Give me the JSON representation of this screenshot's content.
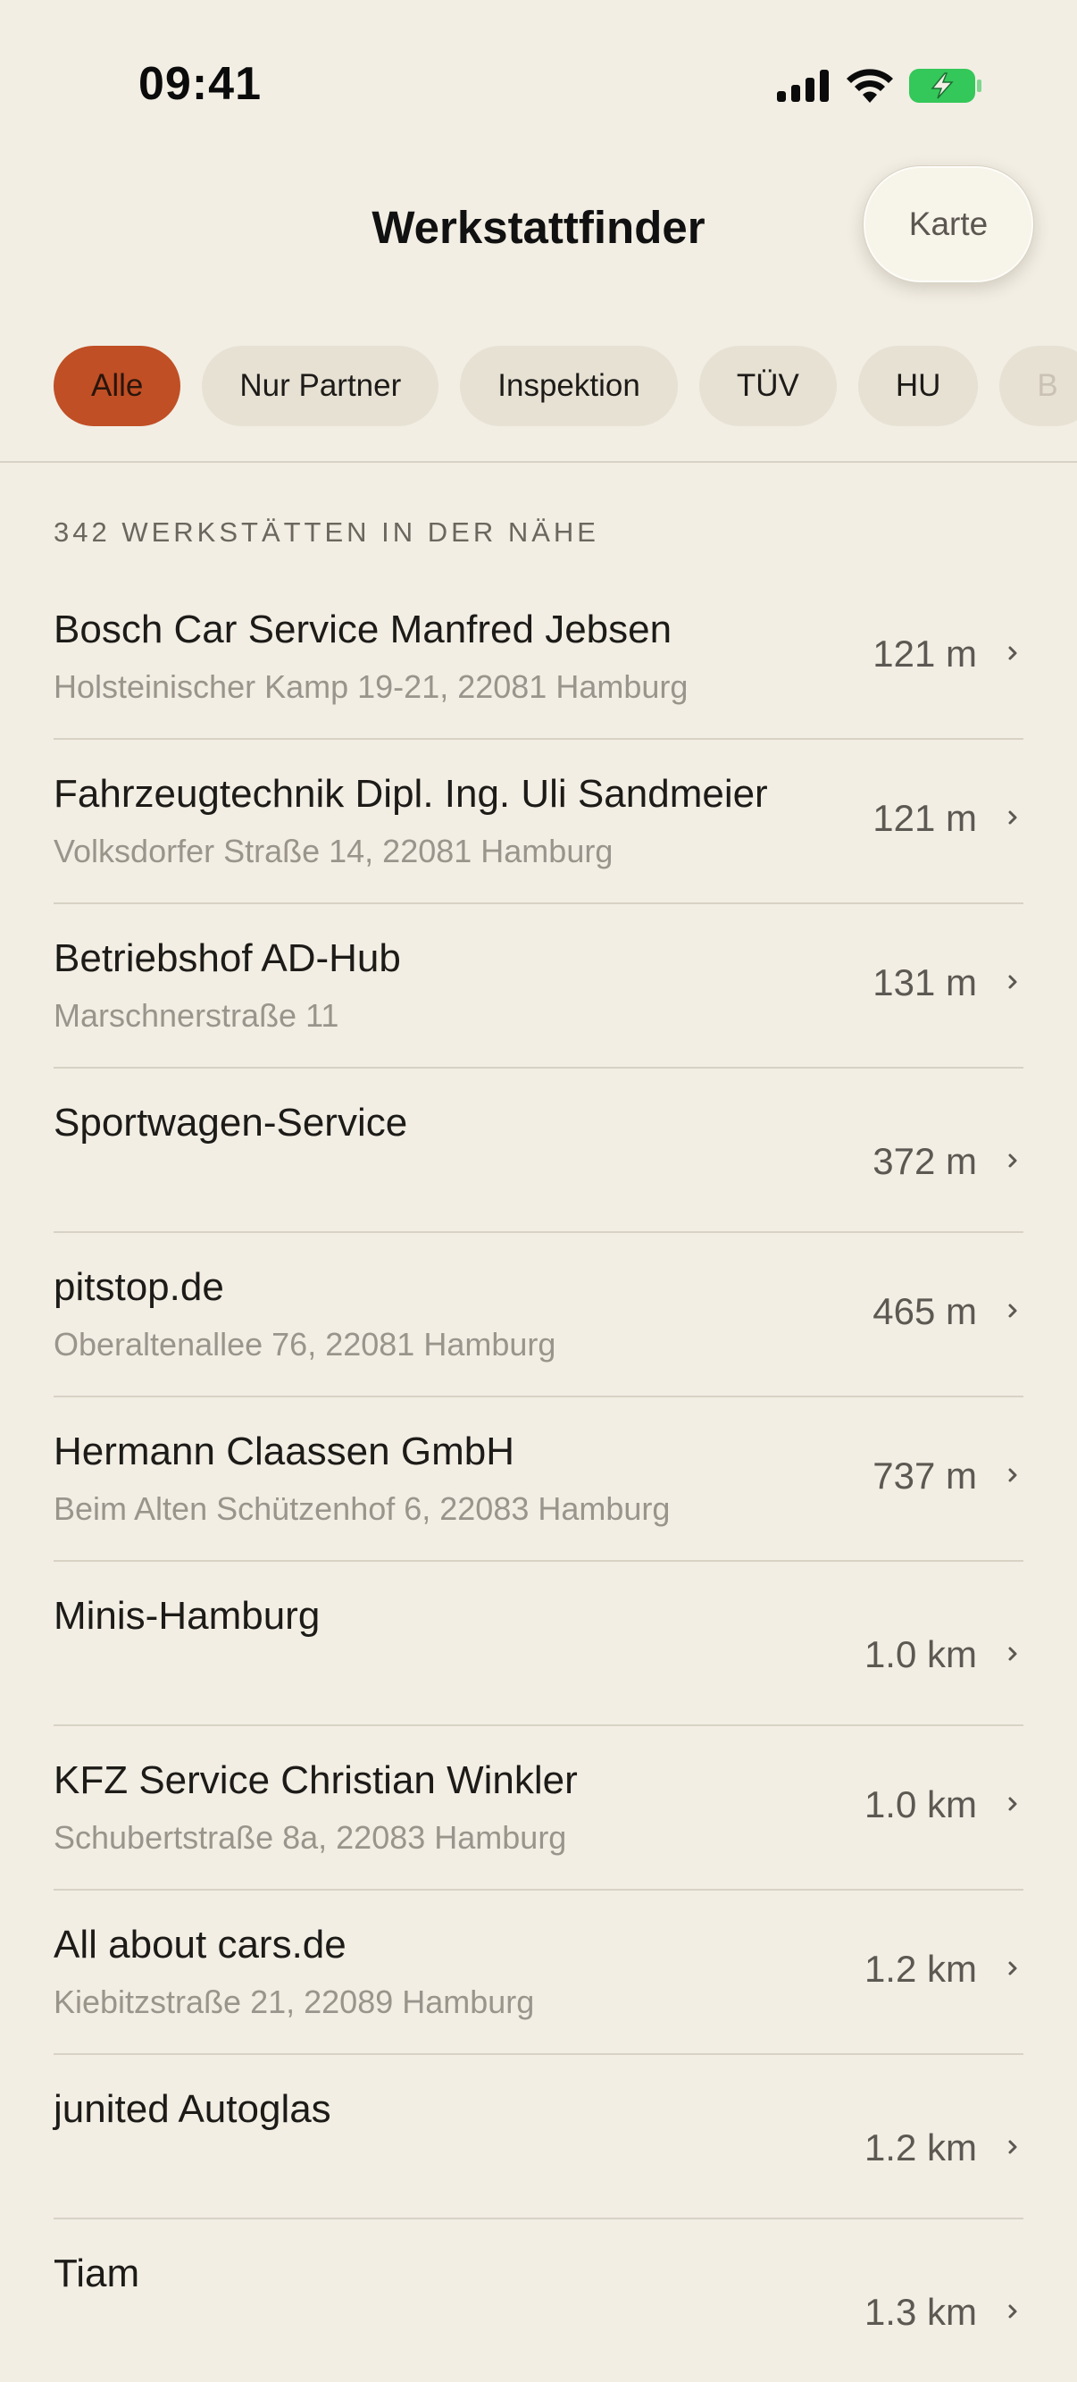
{
  "status_bar": {
    "time": "09:41"
  },
  "nav": {
    "title": "Werkstattfinder",
    "map_button_label": "Karte"
  },
  "filters": [
    {
      "label": "Alle",
      "active": true
    },
    {
      "label": "Nur Partner",
      "active": false
    },
    {
      "label": "Inspektion",
      "active": false
    },
    {
      "label": "TÜV",
      "active": false
    },
    {
      "label": "HU",
      "active": false
    },
    {
      "label": "B",
      "active": false
    }
  ],
  "list": {
    "header": "342 WERKSTÄTTEN IN DER NÄHE",
    "items": [
      {
        "name": "Bosch Car Service Manfred Jebsen",
        "address": "Holsteinischer Kamp 19-21, 22081 Hamburg",
        "distance": "121 m"
      },
      {
        "name": "Fahrzeugtechnik Dipl. Ing. Uli Sandmeier",
        "address": "Volksdorfer Straße 14, 22081 Hamburg",
        "distance": "121 m"
      },
      {
        "name": "Betriebshof AD-Hub",
        "address": "Marschnerstraße 11",
        "distance": "131 m"
      },
      {
        "name": "Sportwagen-Service",
        "address": "",
        "distance": "372 m"
      },
      {
        "name": "pitstop.de",
        "address": "Oberaltenallee 76, 22081 Hamburg",
        "distance": "465 m"
      },
      {
        "name": "Hermann Claassen GmbH",
        "address": "Beim Alten Schützenhof 6, 22083 Hamburg",
        "distance": "737 m"
      },
      {
        "name": "Minis-Hamburg",
        "address": "",
        "distance": "1.0 km"
      },
      {
        "name": "KFZ Service Christian Winkler",
        "address": "Schubertstraße 8a, 22083 Hamburg",
        "distance": "1.0 km"
      },
      {
        "name": "All about cars.de",
        "address": "Kiebitzstraße 21, 22089 Hamburg",
        "distance": "1.2 km"
      },
      {
        "name": "junited Autoglas",
        "address": "",
        "distance": "1.2 km"
      },
      {
        "name": "Tiam",
        "address": "",
        "distance": "1.3 km"
      }
    ]
  },
  "colors": {
    "background": "#f2eee4",
    "accent": "#c04f25",
    "chip": "#e7e1d4",
    "battery": "#34c759"
  },
  "icons": [
    "signal-icon",
    "wifi-icon",
    "battery-charging-icon",
    "chevron-right-icon"
  ]
}
